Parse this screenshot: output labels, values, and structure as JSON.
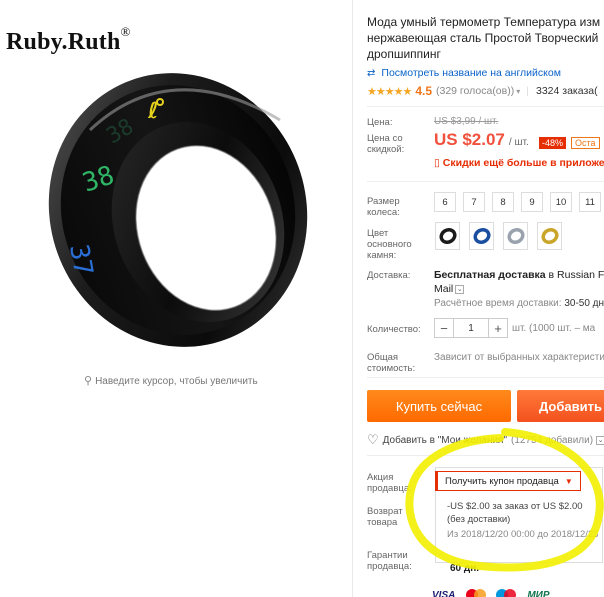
{
  "brand": {
    "name": "Ruby.Ruth",
    "mark": "®"
  },
  "image_hint": {
    "icon": "magnifier-icon",
    "text": "Наведите курсор, чтобы увеличить"
  },
  "ring_digits": {
    "top": "38",
    "mid": "38",
    "bottom": "37"
  },
  "title_lines": [
    "Мода умный термометр Температура изм",
    "нержавеющая сталь Простой Творческий",
    "дропшиппинг"
  ],
  "translate": {
    "icon": "translate-icon",
    "text": "Посмотреть название на английском"
  },
  "rating": {
    "stars": "★★★★★",
    "value": "4.5",
    "votes": "(329 голоса(ов))",
    "orders": "3324 заказа("
  },
  "price": {
    "label": "Цена:",
    "old": "US $3,99 / шт.",
    "discount_label": "Цена со скидкой:",
    "new": "US $2.07",
    "unit": "/ шт.",
    "discount": "-48%",
    "remaining": "Оста",
    "app_discount": "Скидки ещё больше в приложени"
  },
  "size": {
    "label": "Размер колеса:",
    "options": [
      "6",
      "7",
      "8",
      "9",
      "10",
      "11"
    ]
  },
  "stone": {
    "label": "Цвет основного камня:",
    "colors": [
      "#1b1b1b",
      "#1a4fa0",
      "#9aa3ad",
      "#c9a52a"
    ]
  },
  "shipping": {
    "label": "Доставка:",
    "free": "Бесплатная доставка",
    "via": "в Russian Fed",
    "mail": "Mail",
    "eta_label": "Расчётное время доставки:",
    "eta_value": "30-50 дн"
  },
  "quantity": {
    "label": "Количество:",
    "minus": "−",
    "value": "1",
    "plus": "+",
    "note": "шт. (1000 шт. – ма"
  },
  "total": {
    "label": "Общая стоимость:",
    "note": "Зависит от выбранных характеристи"
  },
  "buttons": {
    "buy": "Купить сейчас",
    "cart": "Добавить"
  },
  "wishlist": {
    "icon": "heart-icon",
    "text": "Добавить в \"Мои желания\"",
    "count": "(12754 добавили)"
  },
  "seller_promo": {
    "label": "Акция продавца:",
    "coupon_button": "Получить купон продавца",
    "coupon_line1": "-US $2.00 за заказ от US $2.00",
    "coupon_line2": "(без доставки)",
    "coupon_dates": "Из 2018/12/20 00:00 до 2018/12/23"
  },
  "returns": {
    "label": "Возврат товара"
  },
  "guarantee": {
    "label": "Гарантии продавца:",
    "value": "60 дн."
  },
  "payments": [
    "VISA",
    "",
    "",
    "МИР"
  ],
  "colors": {
    "accent": "#ff6a00",
    "price": "#f0503c",
    "link": "#0b63c8",
    "highlight": "#f5f500"
  }
}
